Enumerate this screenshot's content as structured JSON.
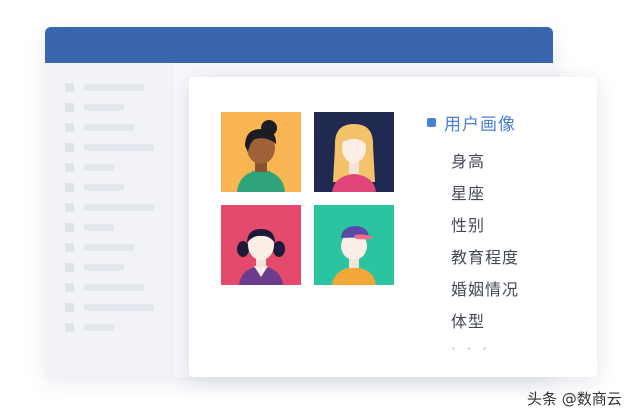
{
  "menu": {
    "title": "用户画像",
    "items": [
      "身高",
      "星座",
      "性别",
      "教育程度",
      "婚姻情况",
      "体型"
    ],
    "ellipsis": "· · ·"
  },
  "avatars": [
    {
      "name": "avatar-dark-skin-woman",
      "bg": "#f9b552"
    },
    {
      "name": "avatar-blonde-woman",
      "bg": "#20294f"
    },
    {
      "name": "avatar-girl-pigtails",
      "bg": "#e34a6c"
    },
    {
      "name": "avatar-boy-cap",
      "bg": "#2bc4a1"
    }
  ],
  "colors": {
    "title_bar": "#3b66ad",
    "accent": "#4a7fd6"
  },
  "watermark": "头条 @数商云"
}
